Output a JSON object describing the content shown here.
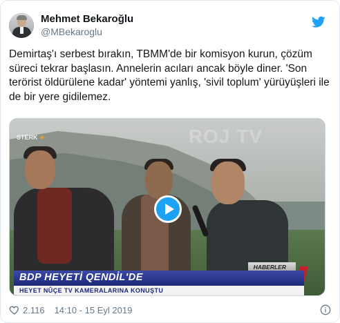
{
  "tweet": {
    "display_name": "Mehmet Bekaroğlu",
    "handle": "@MBekaroglu",
    "text": "Demirtaş'ı serbest bırakın, TBMM'de bir komisyon kurun, çözüm süreci tekrar başlasın. Annelerin acıları ancak böyle diner. 'Son terörist öldürülene kadar' yöntemi yanlış, 'sivil toplum' yürüyüşleri ile de bir yere gidilemez.",
    "likes": "2.116",
    "timestamp": "14:10 - 15 Eyl 2019"
  },
  "media": {
    "channel_logo": "STERK",
    "watermark": "ROJ TV",
    "ticker_tag": "HABERLER",
    "ticker_headline": "BDP HEYETİ QENDİL'DE",
    "ticker_subline": "HEYET NÛÇE TV KAMERALARINA KONUŞTU"
  },
  "colors": {
    "accent": "#1da1f2",
    "text": "#14171a",
    "muted": "#657786"
  },
  "icons": {
    "brand": "twitter-bird-icon",
    "like": "heart-icon",
    "info": "info-icon",
    "play": "play-icon"
  }
}
